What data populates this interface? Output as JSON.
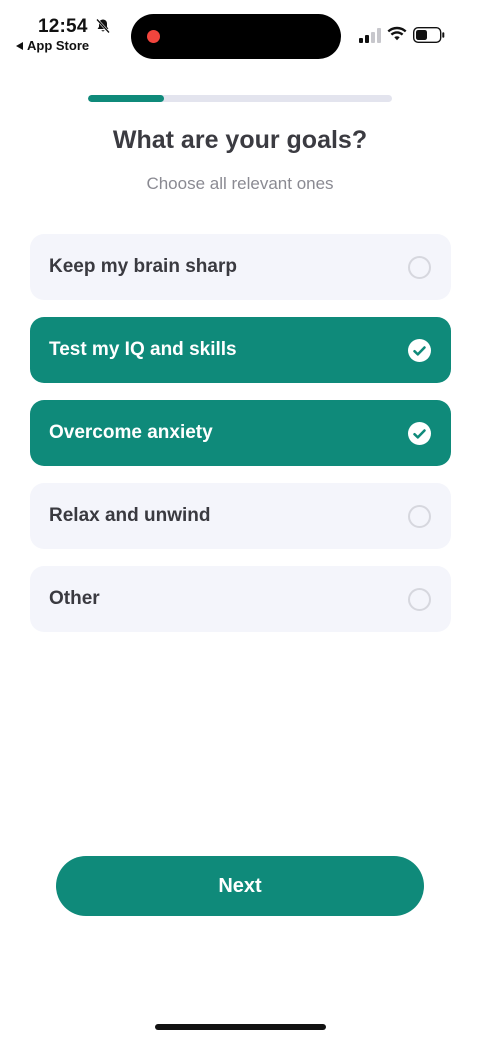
{
  "status_bar": {
    "time": "12:54",
    "back_label": "App Store",
    "icons": [
      "bell-slash-icon",
      "signal-icon",
      "wifi-icon",
      "battery-icon"
    ]
  },
  "progress": {
    "fraction": 0.25
  },
  "header": {
    "title": "What are your goals?",
    "subtitle": "Choose all relevant ones"
  },
  "options": [
    {
      "label": "Keep my brain sharp",
      "selected": false
    },
    {
      "label": "Test my IQ and skills",
      "selected": true
    },
    {
      "label": "Overcome anxiety",
      "selected": true
    },
    {
      "label": "Relax and unwind",
      "selected": false
    },
    {
      "label": "Other",
      "selected": false
    }
  ],
  "footer": {
    "next_label": "Next"
  },
  "colors": {
    "accent": "#0f8a7a",
    "option_bg": "#f4f5fb",
    "recording": "#f2453d"
  }
}
